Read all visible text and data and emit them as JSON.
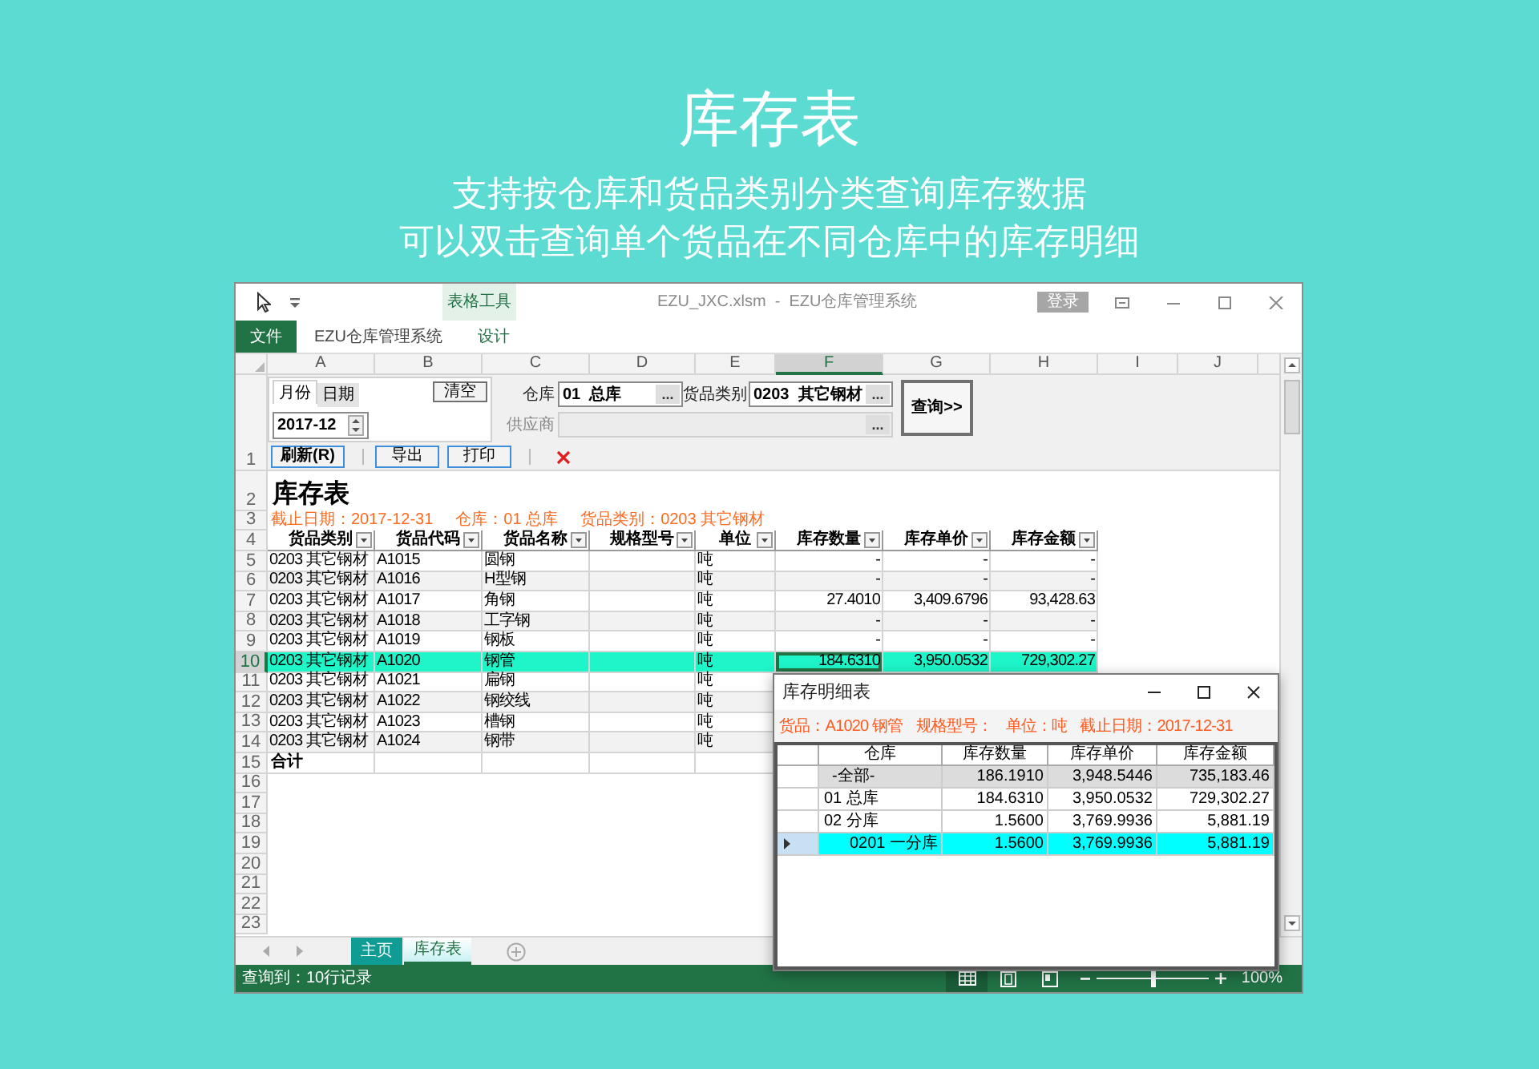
{
  "page": {
    "title": "库存表",
    "subtitle_lines": [
      "支持按仓库和货品类别分类查询库存数据",
      "可以双击查询单个货品在不同仓库中的库存明细"
    ]
  },
  "window": {
    "context_tab": "表格工具",
    "title": "EZU_JXC.xlsm  -  EZU仓库管理系统",
    "login_button": "登录"
  },
  "ribbon_tabs": [
    {
      "label": "文件",
      "kind": "file"
    },
    {
      "label": "EZU仓库管理系统",
      "kind": "tab"
    },
    {
      "label": "设计",
      "kind": "context"
    }
  ],
  "column_headers": [
    {
      "label": "A",
      "selected": false
    },
    {
      "label": "B",
      "selected": false
    },
    {
      "label": "C",
      "selected": false
    },
    {
      "label": "D",
      "selected": false
    },
    {
      "label": "E",
      "selected": false
    },
    {
      "label": "F",
      "selected": true
    },
    {
      "label": "G",
      "selected": false
    },
    {
      "label": "H",
      "selected": false
    },
    {
      "label": "I",
      "selected": false
    },
    {
      "label": "J",
      "selected": false
    }
  ],
  "row_numbers": [
    {
      "label": "1",
      "selected": false
    },
    {
      "label": "2",
      "selected": false
    },
    {
      "label": "3",
      "selected": false
    },
    {
      "label": "4",
      "selected": false
    },
    {
      "label": "5",
      "selected": false
    },
    {
      "label": "6",
      "selected": false
    },
    {
      "label": "7",
      "selected": false
    },
    {
      "label": "8",
      "selected": false
    },
    {
      "label": "9",
      "selected": false
    },
    {
      "label": "10",
      "selected": true
    },
    {
      "label": "11",
      "selected": false
    },
    {
      "label": "12",
      "selected": false
    },
    {
      "label": "13",
      "selected": false
    },
    {
      "label": "14",
      "selected": false
    },
    {
      "label": "15",
      "selected": false
    },
    {
      "label": "16",
      "selected": false
    },
    {
      "label": "17",
      "selected": false
    },
    {
      "label": "18",
      "selected": false
    },
    {
      "label": "19",
      "selected": false
    },
    {
      "label": "20",
      "selected": false
    },
    {
      "label": "21",
      "selected": false
    },
    {
      "label": "22",
      "selected": false
    },
    {
      "label": "23",
      "selected": false
    }
  ],
  "query_panel": {
    "date_tabs": [
      {
        "label": "月份",
        "selected": true
      },
      {
        "label": "日期",
        "selected": false
      }
    ],
    "clear_button": "清空",
    "month_value": "2017-12",
    "fields": [
      {
        "label": "仓库",
        "value": "01  总库",
        "button": "...",
        "disabled": false
      },
      {
        "label": "货品类别",
        "value": "0203  其它钢材",
        "button": "...",
        "disabled": false
      },
      {
        "label": "供应商",
        "button": "...",
        "disabled": true
      }
    ],
    "query_button": "查询>>",
    "toolbar": [
      "刷新(R)",
      "导出",
      "打印"
    ]
  },
  "sheet": {
    "title": "库存表",
    "filters": [
      "截止日期：2017-12-31",
      "仓库：01 总库",
      "货品类别：0203 其它钢材"
    ],
    "table": {
      "columns": [
        "货品类别",
        "货品代码",
        "货品名称",
        "规格型号",
        "单位",
        "库存数量",
        "库存单价",
        "库存金额"
      ],
      "rows": [
        {
          "category": "0203 其它钢材",
          "code": "A1015",
          "name": "圆钢",
          "unit": "吨",
          "quantity": "-",
          "unit_price": "-",
          "amount": "-",
          "selected": false
        },
        {
          "category": "0203 其它钢材",
          "code": "A1016",
          "name": "H型钢",
          "unit": "吨",
          "quantity": "-",
          "unit_price": "-",
          "amount": "-",
          "selected": false
        },
        {
          "category": "0203 其它钢材",
          "code": "A1017",
          "name": "角钢",
          "unit": "吨",
          "quantity": "27.4010",
          "unit_price": "3,409.6796",
          "amount": "93,428.63",
          "selected": false
        },
        {
          "category": "0203 其它钢材",
          "code": "A1018",
          "name": "工字钢",
          "unit": "吨",
          "quantity": "-",
          "unit_price": "-",
          "amount": "-",
          "selected": false
        },
        {
          "category": "0203 其它钢材",
          "code": "A1019",
          "name": "钢板",
          "unit": "吨",
          "quantity": "-",
          "unit_price": "-",
          "amount": "-",
          "selected": false
        },
        {
          "category": "0203 其它钢材",
          "code": "A1020",
          "name": "钢管",
          "unit": "吨",
          "quantity": "184.6310",
          "unit_price": "3,950.0532",
          "amount": "729,302.27",
          "selected": true
        },
        {
          "category": "0203 其它钢材",
          "code": "A1021",
          "name": "扁钢",
          "unit": "吨",
          "selected": false
        },
        {
          "category": "0203 其它钢材",
          "code": "A1022",
          "name": "钢绞线",
          "unit": "吨",
          "selected": false
        },
        {
          "category": "0203 其它钢材",
          "code": "A1023",
          "name": "槽钢",
          "unit": "吨",
          "selected": false
        },
        {
          "category": "0203 其它钢材",
          "code": "A1024",
          "name": "钢带",
          "unit": "吨",
          "selected": false
        }
      ],
      "total_label": "合计"
    }
  },
  "detail_dialog": {
    "title": "库存明细表",
    "info": [
      "货品：A1020 钢管",
      "规格型号：",
      "单位：吨",
      "截止日期：2017-12-31"
    ],
    "columns": [
      "仓库",
      "库存数量",
      "库存单价",
      "库存金额"
    ],
    "rows": [
      {
        "kind": "total",
        "warehouse": "-全部-",
        "quantity": "186.1910",
        "unit_price": "3,948.5446",
        "amount": "735,183.46",
        "selected": false
      },
      {
        "kind": "item",
        "warehouse": "01 总库",
        "quantity": "184.6310",
        "unit_price": "3,950.0532",
        "amount": "729,302.27",
        "selected": false
      },
      {
        "kind": "item",
        "warehouse": "02 分库",
        "quantity": "1.5600",
        "unit_price": "3,769.9936",
        "amount": "5,881.19",
        "selected": false,
        "children": [
          {
            "kind": "item",
            "warehouse": "0201 一分库",
            "quantity": "1.5600",
            "unit_price": "3,769.9936",
            "amount": "5,881.19",
            "selected": true
          }
        ]
      }
    ]
  },
  "sheet_tabs": [
    {
      "label": "主页",
      "selected": false
    },
    {
      "label": "库存表",
      "selected": true
    }
  ],
  "status_bar": {
    "text": "查询到：10行记录",
    "zoom": {
      "level": 0.5,
      "label": "100%"
    }
  }
}
